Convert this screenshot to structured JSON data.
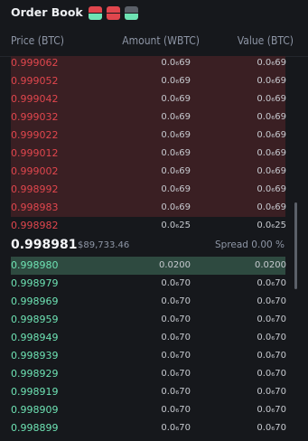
{
  "header": {
    "title": "Order Book",
    "view_buttons": [
      {
        "name": "view-both-button",
        "top_color": "#e0464d",
        "bottom_color": "#6ee3b4"
      },
      {
        "name": "view-asks-button",
        "top_color": "#e0464d",
        "bottom_color": "#e0464d"
      },
      {
        "name": "view-bids-button",
        "top_color": "#5b6069",
        "bottom_color": "#6ee3b4"
      }
    ]
  },
  "columns": {
    "price": "Price (BTC)",
    "amount": "Amount (WBTC)",
    "value": "Value (BTC)"
  },
  "asks": [
    {
      "price": "0.999062",
      "amount": "0.0₆69",
      "value": "0.0₆69",
      "depth": 1
    },
    {
      "price": "0.999052",
      "amount": "0.0₆69",
      "value": "0.0₆69",
      "depth": 1
    },
    {
      "price": "0.999042",
      "amount": "0.0₆69",
      "value": "0.0₆69",
      "depth": 1
    },
    {
      "price": "0.999032",
      "amount": "0.0₆69",
      "value": "0.0₆69",
      "depth": 1
    },
    {
      "price": "0.999022",
      "amount": "0.0₆69",
      "value": "0.0₆69",
      "depth": 1
    },
    {
      "price": "0.999012",
      "amount": "0.0₆69",
      "value": "0.0₆69",
      "depth": 1
    },
    {
      "price": "0.999002",
      "amount": "0.0₆69",
      "value": "0.0₆69",
      "depth": 1
    },
    {
      "price": "0.998992",
      "amount": "0.0₆69",
      "value": "0.0₆69",
      "depth": 1
    },
    {
      "price": "0.998983",
      "amount": "0.0₆69",
      "value": "0.0₆69",
      "depth": 1
    },
    {
      "price": "0.998982",
      "amount": "0.0₆25",
      "value": "0.0₆25",
      "depth": 0
    }
  ],
  "mid": {
    "price": "0.998981",
    "usd": "$89,733.46",
    "spread": "Spread 0.00 %"
  },
  "bids": [
    {
      "price": "0.998980",
      "amount": "0.0200",
      "value": "0.0200",
      "depth": 1
    },
    {
      "price": "0.998979",
      "amount": "0.0₆70",
      "value": "0.0₆70",
      "depth": 0
    },
    {
      "price": "0.998969",
      "amount": "0.0₆70",
      "value": "0.0₆70",
      "depth": 0
    },
    {
      "price": "0.998959",
      "amount": "0.0₆70",
      "value": "0.0₆70",
      "depth": 0
    },
    {
      "price": "0.998949",
      "amount": "0.0₆70",
      "value": "0.0₆70",
      "depth": 0
    },
    {
      "price": "0.998939",
      "amount": "0.0₆70",
      "value": "0.0₆70",
      "depth": 0
    },
    {
      "price": "0.998929",
      "amount": "0.0₆70",
      "value": "0.0₆70",
      "depth": 0
    },
    {
      "price": "0.998919",
      "amount": "0.0₆70",
      "value": "0.0₆70",
      "depth": 0
    },
    {
      "price": "0.998909",
      "amount": "0.0₆70",
      "value": "0.0₆70",
      "depth": 0
    },
    {
      "price": "0.998899",
      "amount": "0.0₆70",
      "value": "0.0₆70",
      "depth": 0
    }
  ],
  "colors": {
    "ask": "#e0464d",
    "bid": "#6ee3b4",
    "ask_depth": "#3a1f23",
    "bid_depth": "#2e4a40"
  }
}
